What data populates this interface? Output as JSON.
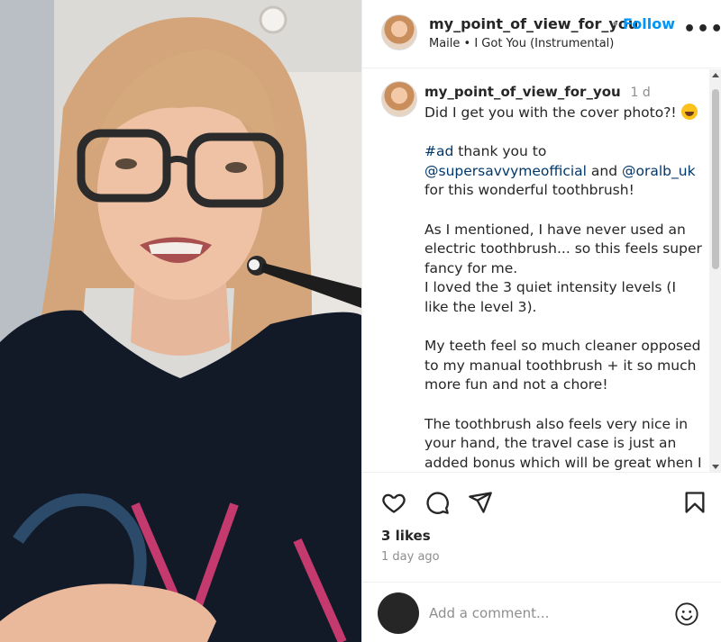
{
  "header": {
    "username": "my_point_of_view_for_you",
    "separator": "•",
    "follow_label": "Follow",
    "audio": "Maile • I Got You (Instrumental)",
    "more_label": "•••"
  },
  "caption": {
    "username": "my_point_of_view_for_you",
    "time": "1 d",
    "lines": {
      "l1": "Did I get you with the cover photo?!",
      "hashtag": "#ad",
      "l2": " thank you to",
      "mention1": "@supersavvymeofficial",
      "and": " and ",
      "mention2": "@oralb_uk",
      "l3": "for this wonderful toothbrush!",
      "l4": "As I mentioned, I have never used an electric toothbrush... so this feels super fancy for me.",
      "l5": "I loved the 3 quiet intensity levels (I like the level 3).",
      "l6": "My teeth feel so much cleaner opposed to my manual toothbrush + it so much more fun and not a chore!",
      "l7": "The toothbrush also feels very nice in your hand, the travel case is just an added bonus which will be great when I go on holiday."
    }
  },
  "stats": {
    "likes": "3 likes",
    "posted": "1 day ago"
  },
  "comment_box": {
    "placeholder": "Add a comment..."
  },
  "icons": {
    "like": "heart-icon",
    "comment": "comment-icon",
    "share": "send-icon",
    "save": "bookmark-icon",
    "emoji": "smiley-icon"
  },
  "colors": {
    "accent": "#0095f6",
    "link": "#00376b",
    "muted": "#8e8e8e"
  }
}
